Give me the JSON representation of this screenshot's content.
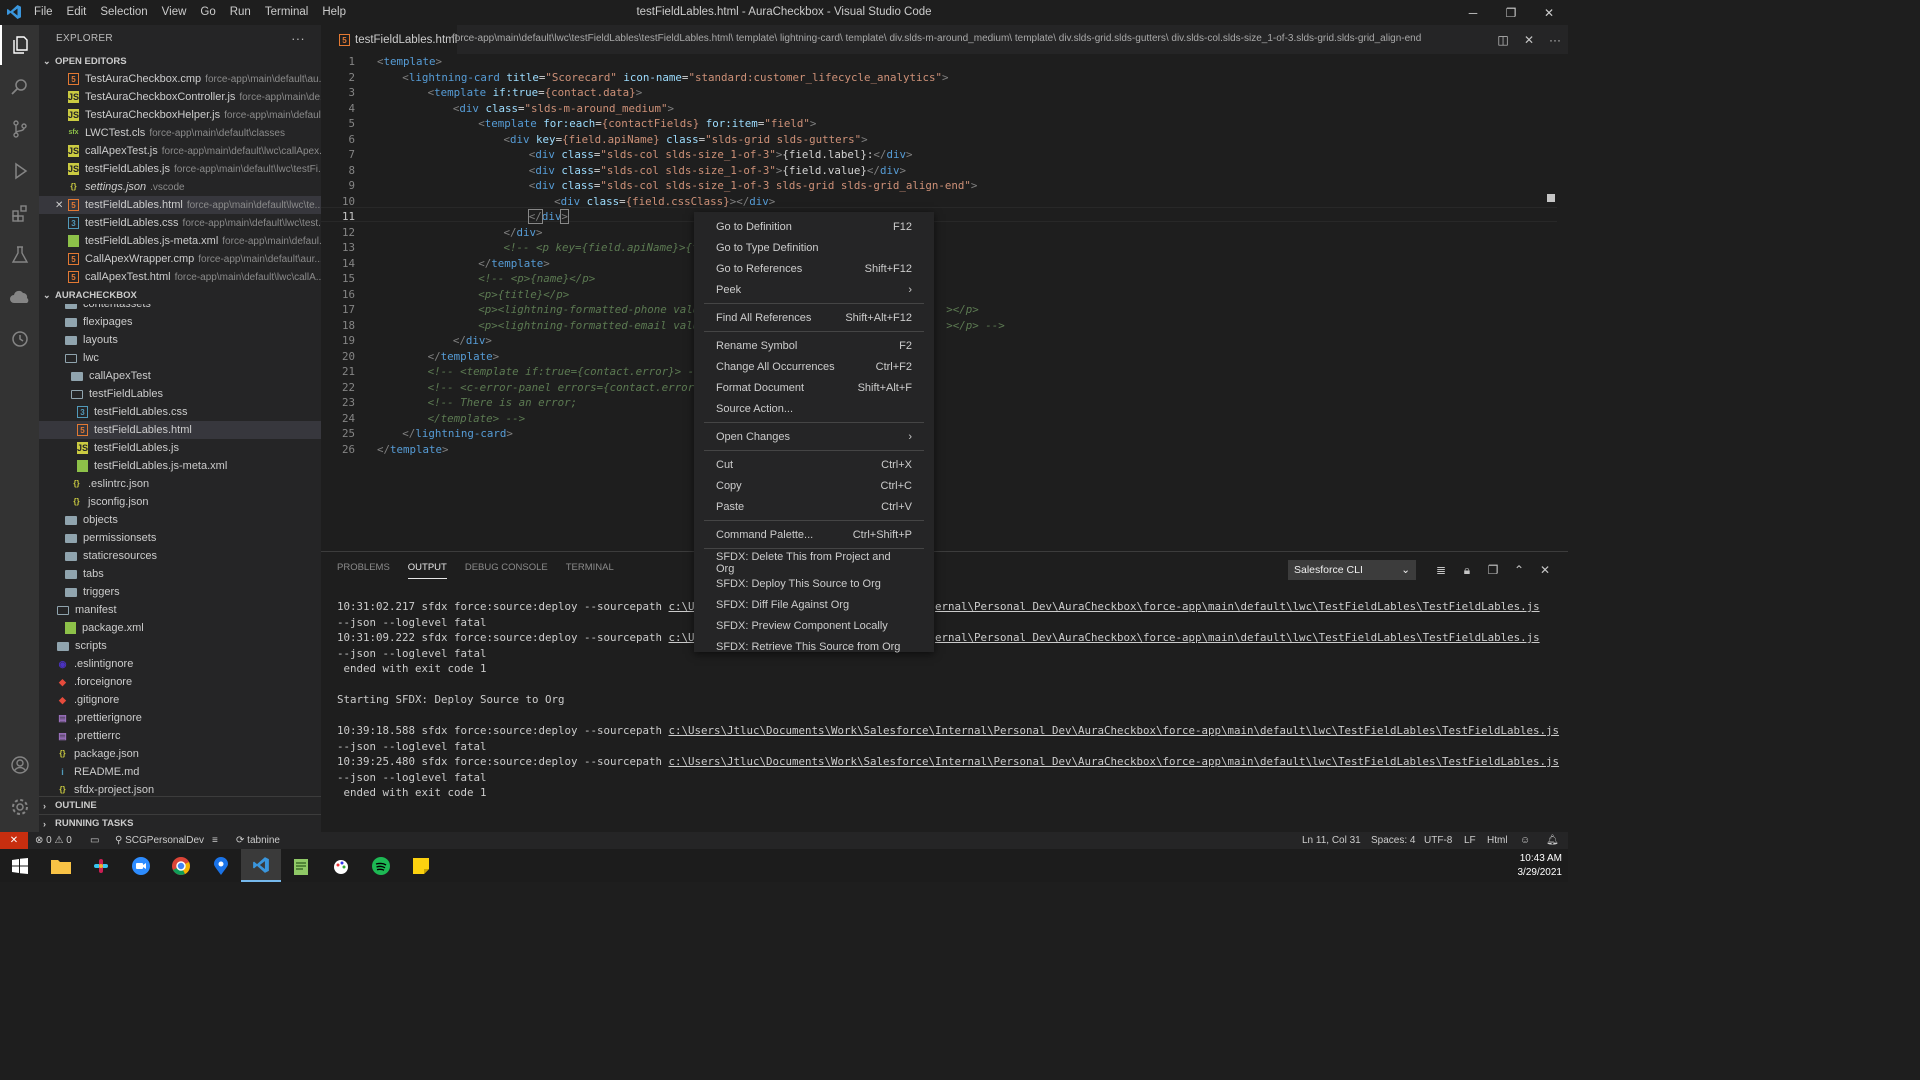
{
  "title": {
    "window": "testFieldLables.html - AuraCheckbox - Visual Studio Code",
    "menu": [
      "File",
      "Edit",
      "Selection",
      "View",
      "Go",
      "Run",
      "Terminal",
      "Help"
    ]
  },
  "explorer": {
    "header": "EXPLORER",
    "open_editors": "OPEN EDITORS",
    "project": "AURACHECKBOX",
    "outline": "OUTLINE",
    "running": "RUNNING TASKS",
    "open_files": [
      {
        "name": "TestAuraCheckbox.cmp",
        "path": "force-app\\main\\default\\au..."
      },
      {
        "name": "TestAuraCheckboxController.js",
        "path": "force-app\\main\\de..."
      },
      {
        "name": "TestAuraCheckboxHelper.js",
        "path": "force-app\\main\\defaul..."
      },
      {
        "name": "LWCTest.cls",
        "path": "force-app\\main\\default\\classes"
      },
      {
        "name": "callApexTest.js",
        "path": "force-app\\main\\default\\lwc\\callApex..."
      },
      {
        "name": "testFieldLables.js",
        "path": "force-app\\main\\default\\lwc\\testFi..."
      },
      {
        "name": "settings.json",
        "path": ".vscode"
      },
      {
        "name": "testFieldLables.html",
        "path": "force-app\\main\\default\\lwc\\te..."
      },
      {
        "name": "testFieldLables.css",
        "path": "force-app\\main\\default\\lwc\\test..."
      },
      {
        "name": "testFieldLables.js-meta.xml",
        "path": "force-app\\main\\defaul..."
      },
      {
        "name": "CallApexWrapper.cmp",
        "path": "force-app\\main\\default\\aur..."
      },
      {
        "name": "callApexTest.html",
        "path": "force-app\\main\\default\\lwc\\callA..."
      }
    ],
    "tree": [
      "contentassets",
      "flexipages",
      "layouts",
      "lwc",
      "callApexTest",
      "testFieldLables",
      "testFieldLables.css",
      "testFieldLables.html",
      "testFieldLables.js",
      "testFieldLables.js-meta.xml",
      ".eslintrc.json",
      "jsconfig.json",
      "objects",
      "permissionsets",
      "staticresources",
      "tabs",
      "triggers",
      "manifest",
      "package.xml",
      "scripts",
      ".eslintignore",
      ".forceignore",
      ".gitignore",
      ".prettierignore",
      ".prettierrc",
      "package.json",
      "README.md",
      "sfdx-project.json"
    ]
  },
  "editor": {
    "tab": "testFieldLables.html",
    "breadcrumb": "force-app\\main\\default\\lwc\\testFieldLables\\testFieldLables.html\\ template\\ lightning-card\\ template\\ div.slds-m-around_medium\\ template\\ div.slds-grid.slds-gutters\\ div.slds-col.slds-size_1-of-3.slds-grid.slds-grid_align-end"
  },
  "context_menu": [
    {
      "label": "Go to Definition",
      "key": "F12"
    },
    {
      "label": "Go to Type Definition",
      "key": ""
    },
    {
      "label": "Go to References",
      "key": "Shift+F12"
    },
    {
      "label": "Peek",
      "key": "›"
    },
    {
      "sep": true
    },
    {
      "label": "Find All References",
      "key": "Shift+Alt+F12"
    },
    {
      "sep": true
    },
    {
      "label": "Rename Symbol",
      "key": "F2"
    },
    {
      "label": "Change All Occurrences",
      "key": "Ctrl+F2"
    },
    {
      "label": "Format Document",
      "key": "Shift+Alt+F"
    },
    {
      "label": "Source Action...",
      "key": ""
    },
    {
      "sep": true
    },
    {
      "label": "Open Changes",
      "key": "›"
    },
    {
      "sep": true
    },
    {
      "label": "Cut",
      "key": "Ctrl+X"
    },
    {
      "label": "Copy",
      "key": "Ctrl+C"
    },
    {
      "label": "Paste",
      "key": "Ctrl+V"
    },
    {
      "sep": true
    },
    {
      "label": "Command Palette...",
      "key": "Ctrl+Shift+P"
    },
    {
      "sep": true
    },
    {
      "label": "SFDX: Delete This from Project and Org",
      "key": ""
    },
    {
      "label": "SFDX: Deploy This Source to Org",
      "key": ""
    },
    {
      "label": "SFDX: Diff File Against Org",
      "key": ""
    },
    {
      "label": "SFDX: Preview Component Locally",
      "key": ""
    },
    {
      "label": "SFDX: Retrieve This Source from Org",
      "key": ""
    }
  ],
  "panel": {
    "tabs": [
      "PROBLEMS",
      "OUTPUT",
      "DEBUG CONSOLE",
      "TERMINAL"
    ],
    "channel": "Salesforce CLI"
  },
  "status": {
    "errors": "0",
    "warnings": "0",
    "org": "SCGPersonalDev",
    "tabnine": "tabnine",
    "pos": "Ln 11, Col 31",
    "spaces": "Spaces: 4",
    "enc": "UTF-8",
    "eol": "LF",
    "lang": "Html"
  },
  "clock": {
    "time": "10:43 AM",
    "date": "3/29/2021"
  }
}
